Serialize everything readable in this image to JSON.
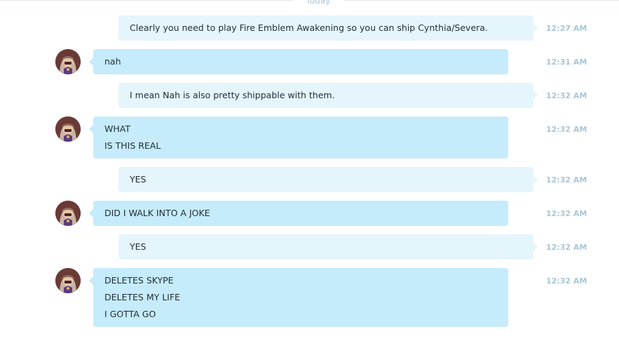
{
  "day_label": "Today",
  "messages": [
    {
      "direction": "out",
      "time": "12:27 AM",
      "lines": [
        "Clearly you need to play Fire Emblem Awakening so you can ship Cynthia/Severa."
      ]
    },
    {
      "direction": "in",
      "time": "12:31 AM",
      "lines": [
        "nah"
      ]
    },
    {
      "direction": "out",
      "time": "12:32 AM",
      "lines": [
        "I mean Nah is also pretty shippable with them."
      ]
    },
    {
      "direction": "in",
      "time": "12:32 AM",
      "lines": [
        "WHAT",
        "IS THIS REAL"
      ]
    },
    {
      "direction": "out",
      "time": "12:32 AM",
      "lines": [
        "YES"
      ]
    },
    {
      "direction": "in",
      "time": "12:32 AM",
      "lines": [
        "DID I WALK INTO A JOKE"
      ]
    },
    {
      "direction": "out",
      "time": "12:32 AM",
      "lines": [
        "YES"
      ]
    },
    {
      "direction": "in",
      "time": "12:32 AM",
      "lines": [
        "DELETES SKYPE",
        "DELETES MY LIFE",
        "I GOTTA GO"
      ]
    }
  ],
  "colors": {
    "outgoing_bubble": "#e5f5fc",
    "incoming_bubble": "#c6ebfa",
    "timestamp": "#a9c6d8"
  },
  "icons": {
    "avatar": "user-avatar"
  }
}
